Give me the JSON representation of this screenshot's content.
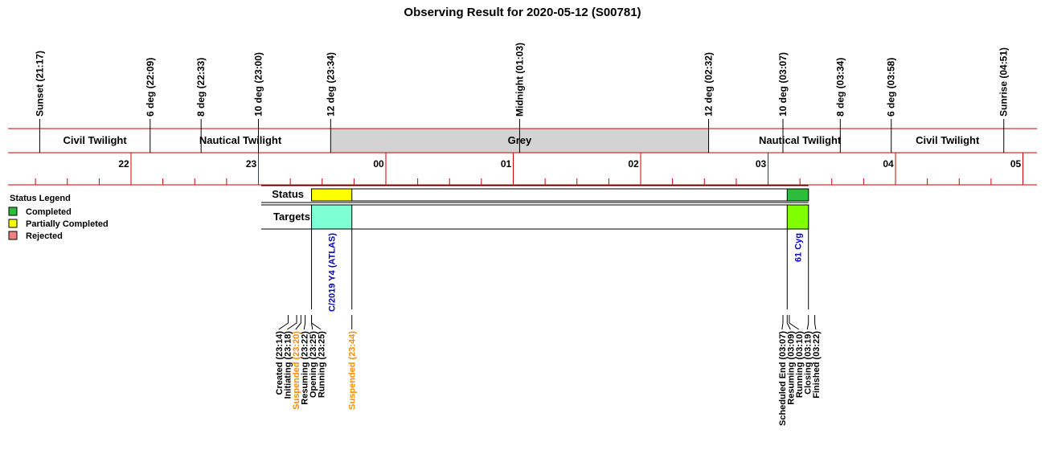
{
  "title": "Observing Result for 2020-05-12 (S00781)",
  "chart_data": {
    "type": "timeline",
    "date": "2020-05-12",
    "session_id": "S00781",
    "time_axis": {
      "start": "21:17",
      "end": "05:05",
      "hour_ticks": [
        "22",
        "23",
        "00",
        "01",
        "02",
        "03",
        "04",
        "05"
      ]
    },
    "sky_events": [
      {
        "label": "Sunset (21:17)",
        "time": "21:17"
      },
      {
        "label": "6 deg (22:09)",
        "time": "22:09"
      },
      {
        "label": "8 deg (22:33)",
        "time": "22:33"
      },
      {
        "label": "10 deg (23:00)",
        "time": "23:00"
      },
      {
        "label": "12 deg (23:34)",
        "time": "23:34"
      },
      {
        "label": "Midnight (01:03)",
        "time": "01:03"
      },
      {
        "label": "12 deg (02:32)",
        "time": "02:32"
      },
      {
        "label": "10 deg (03:07)",
        "time": "03:07"
      },
      {
        "label": "8 deg (03:34)",
        "time": "03:34"
      },
      {
        "label": "6 deg (03:58)",
        "time": "03:58"
      },
      {
        "label": "Sunrise (04:51)",
        "time": "04:51"
      }
    ],
    "twilight_bands": [
      {
        "label": "Civil Twilight",
        "start": "21:17",
        "end": "22:09",
        "shaded": false
      },
      {
        "label": "Nautical Twilight",
        "start": "22:09",
        "end": "23:34",
        "shaded": false
      },
      {
        "label": "Grey",
        "start": "23:34",
        "end": "02:32",
        "shaded": true
      },
      {
        "label": "Nautical Twilight",
        "start": "02:32",
        "end": "03:58",
        "shaded": false
      },
      {
        "label": "Civil Twilight",
        "start": "03:58",
        "end": "04:51",
        "shaded": false
      }
    ],
    "status_row": {
      "label": "Status",
      "segments": [
        {
          "start": "23:25",
          "end": "23:44",
          "status": "Partially Completed",
          "color": "#ffff00"
        },
        {
          "start": "03:09",
          "end": "03:19",
          "status": "Completed",
          "color": "#2ebd3a"
        }
      ]
    },
    "targets_row": {
      "label": "Targets",
      "targets": [
        {
          "name": "C/2019 Y4 (ATLAS)",
          "start": "23:25",
          "end": "23:44",
          "color": "#7fffd4"
        },
        {
          "name": "61 Cyg",
          "start": "03:09",
          "end": "03:19",
          "color": "#80ff00"
        }
      ]
    },
    "log_events": [
      {
        "label": "Created (23:14)",
        "time": "23:14",
        "color": "#000000"
      },
      {
        "label": "Initiating (23:18)",
        "time": "23:18",
        "color": "#000000"
      },
      {
        "label": "Suspended (23:20)",
        "time": "23:20",
        "color": "#ff8c00"
      },
      {
        "label": "Resuming (23:22)",
        "time": "23:22",
        "color": "#000000"
      },
      {
        "label": "Opening (23:25)",
        "time": "23:25",
        "color": "#000000"
      },
      {
        "label": "Running (23:25)",
        "time": "23:25",
        "color": "#000000"
      },
      {
        "label": "Suspended (23:44)",
        "time": "23:44",
        "color": "#ff8c00"
      },
      {
        "label": "Scheduled End (03:07)",
        "time": "03:07",
        "color": "#000000"
      },
      {
        "label": "Resuming (03:09)",
        "time": "03:09",
        "color": "#000000"
      },
      {
        "label": "Running (03:10)",
        "time": "03:10",
        "color": "#000000"
      },
      {
        "label": "Closing (03:19)",
        "time": "03:19",
        "color": "#000000"
      },
      {
        "label": "Finished (03:22)",
        "time": "03:22",
        "color": "#000000"
      }
    ],
    "legend": {
      "title": "Status Legend",
      "placement": "left",
      "items": [
        {
          "label": "Completed",
          "color": "#2ebd3a"
        },
        {
          "label": "Partially Completed",
          "color": "#ffff00"
        },
        {
          "label": "Rejected",
          "color": "#f08080"
        }
      ]
    },
    "colors": {
      "axis_lines": "#cc0000",
      "grey_band": "#d3d3d3",
      "suspended_text": "#ff8c00",
      "target_text": "#0000c0"
    }
  }
}
